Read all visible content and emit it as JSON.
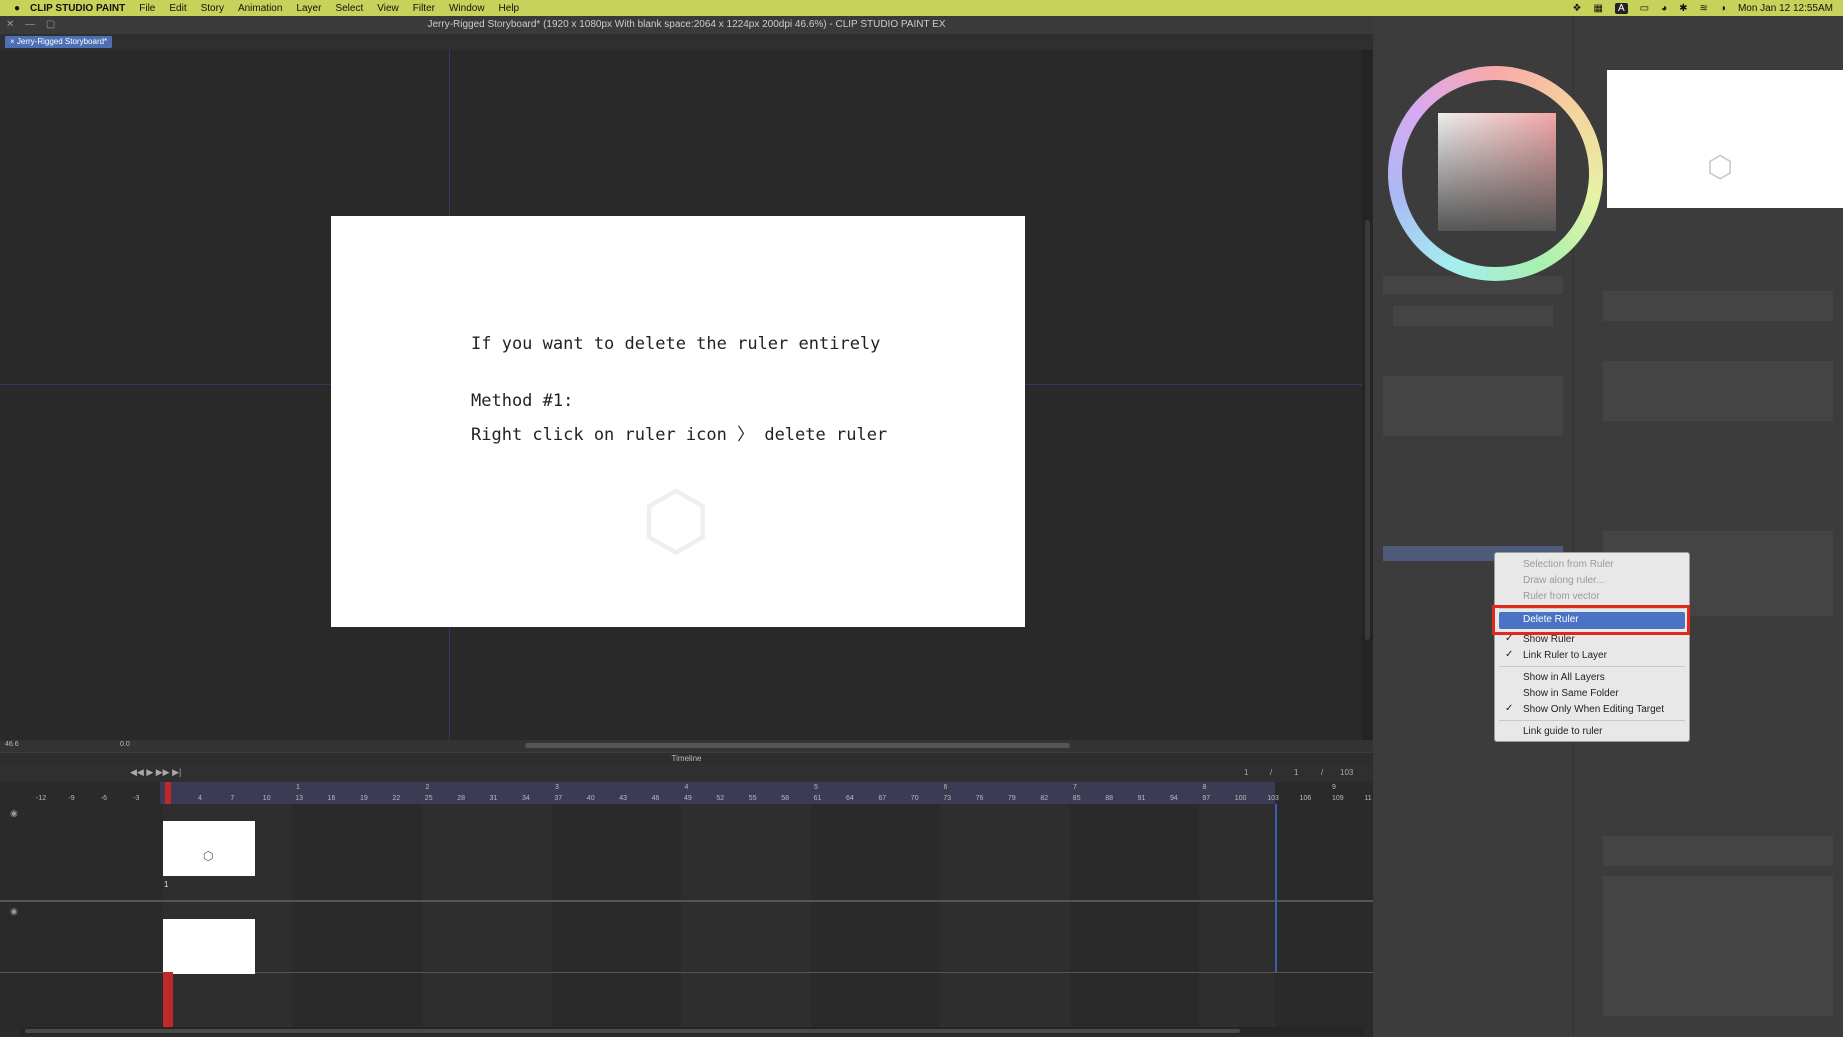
{
  "menubar": {
    "app_name": "CLIP STUDIO PAINT",
    "items": [
      "File",
      "Edit",
      "Story",
      "Animation",
      "Layer",
      "Select",
      "View",
      "Filter",
      "Window",
      "Help"
    ],
    "input_indicator": "A",
    "datetime": "Mon Jan 12  12:55AM"
  },
  "window": {
    "title": "Jerry-Rigged Storyboard* (1920 x 1080px With blank space:2064 x 1224px 200dpi 46.6%)  - CLIP STUDIO PAINT EX",
    "tab": "Jerry-Rigged Storyboard*"
  },
  "canvas": {
    "line1": "If you want to delete the ruler entirely",
    "line2": "Method #1:",
    "line3": "Right click on ruler icon 〉 delete ruler"
  },
  "statusbar": {
    "zoom": "46.6",
    "angle": "0.0"
  },
  "timeline": {
    "title": "Timeline",
    "frame_current": "1",
    "frame_sep1": "/",
    "frame_start": "1",
    "frame_sep2": "/",
    "frame_end": "103",
    "ruler_numbers": [
      "-12",
      "-9",
      "-6",
      "-3",
      "1",
      "4",
      "7",
      "10",
      "13",
      "16",
      "19",
      "22",
      "25",
      "28",
      "31",
      "34",
      "37",
      "40",
      "43",
      "46",
      "49",
      "52",
      "55",
      "58",
      "61",
      "64",
      "67",
      "70",
      "73",
      "76",
      "79",
      "82",
      "85",
      "88",
      "91",
      "94",
      "97",
      "100",
      "103",
      "106",
      "109",
      "11"
    ],
    "second_marks": [
      "1",
      "2",
      "3",
      "4",
      "5",
      "6",
      "7",
      "8",
      "9"
    ],
    "row_label": "1"
  },
  "context_menu": {
    "items": [
      {
        "label": "Selection from Ruler",
        "enabled": false,
        "checked": false
      },
      {
        "label": "Draw along ruler...",
        "enabled": false,
        "checked": false
      },
      {
        "label": "Ruler from vector",
        "enabled": false,
        "checked": false
      },
      {
        "label": "Delete Ruler",
        "enabled": true,
        "checked": false,
        "highlighted": true
      },
      {
        "label": "Show Ruler",
        "enabled": true,
        "checked": true
      },
      {
        "label": "Link Ruler to Layer",
        "enabled": true,
        "checked": true
      },
      {
        "label": "Show in All Layers",
        "enabled": true,
        "checked": false
      },
      {
        "label": "Show in Same Folder",
        "enabled": true,
        "checked": false
      },
      {
        "label": "Show Only When Editing Target",
        "enabled": true,
        "checked": true
      },
      {
        "label": "Link guide to ruler",
        "enabled": true,
        "checked": false
      }
    ]
  },
  "colors": {
    "menubar": "#c7d25a",
    "highlight_outline": "#e0281c",
    "menu_selection": "#4a73c6",
    "playhead": "#c0282a"
  }
}
